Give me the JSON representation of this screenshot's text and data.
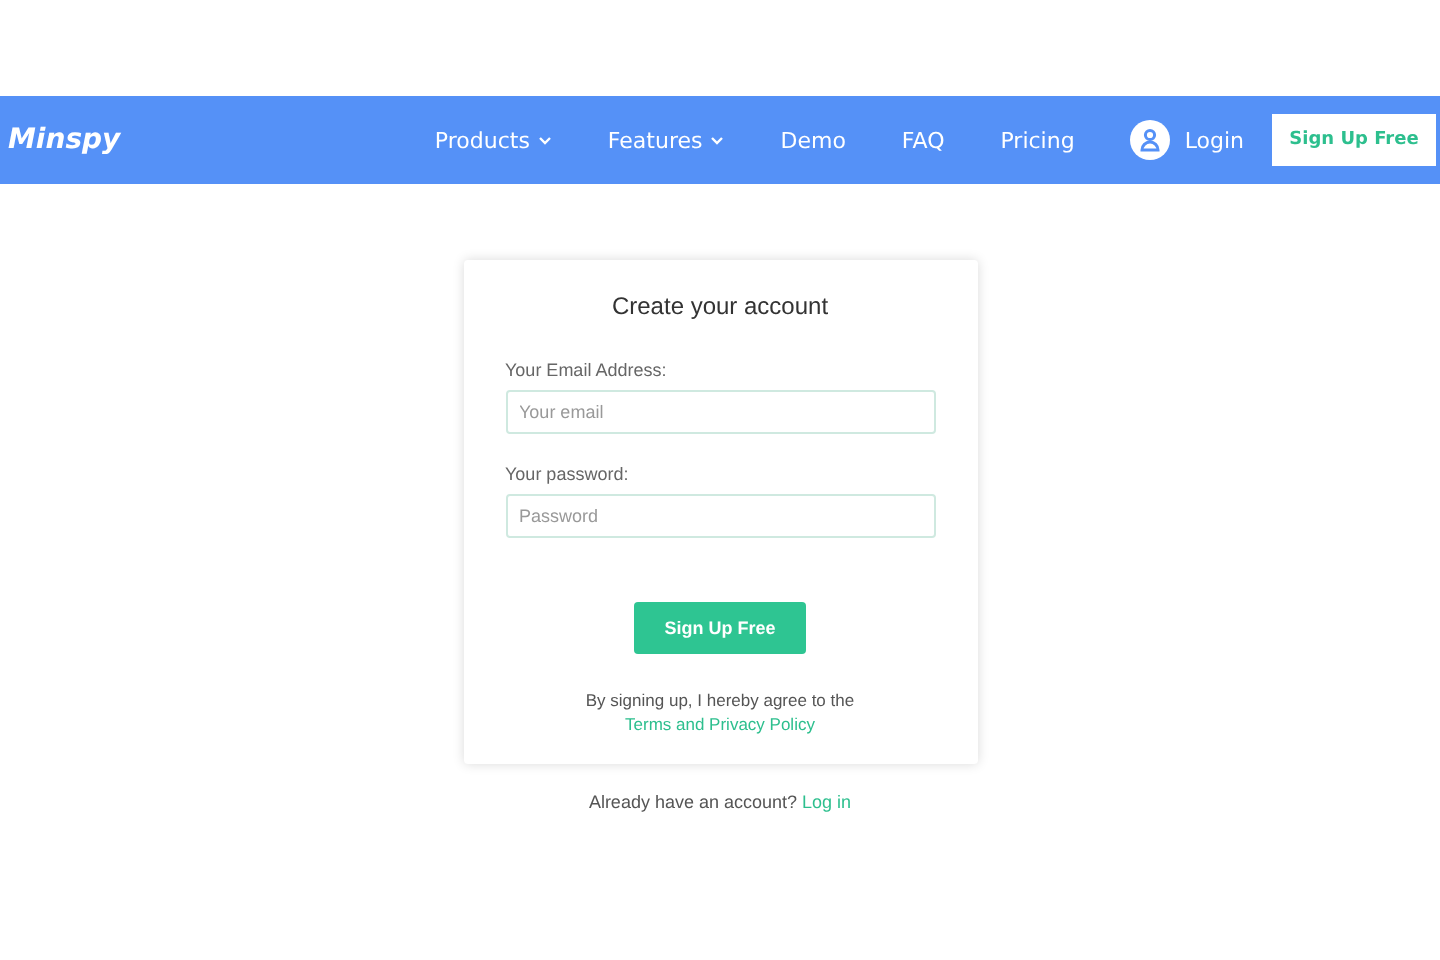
{
  "header": {
    "logo": "Minspy",
    "nav": [
      {
        "label": "Products",
        "has_menu": true
      },
      {
        "label": "Features",
        "has_menu": true
      },
      {
        "label": "Demo",
        "has_menu": false
      },
      {
        "label": "FAQ",
        "has_menu": false
      },
      {
        "label": "Pricing",
        "has_menu": false
      }
    ],
    "login": "Login",
    "signup": "Sign Up Free"
  },
  "form": {
    "title": "Create your account",
    "fields": [
      {
        "label": "Your Email Address:",
        "placeholder": "Your email"
      },
      {
        "label": "Your password:",
        "placeholder": "Password"
      }
    ],
    "submit": "Sign Up Free",
    "terms_text": "By signing up, I hereby agree to the",
    "terms_link": "Terms and Privacy Policy"
  },
  "footer": {
    "text": "Already have an account?",
    "link": "Log in"
  }
}
